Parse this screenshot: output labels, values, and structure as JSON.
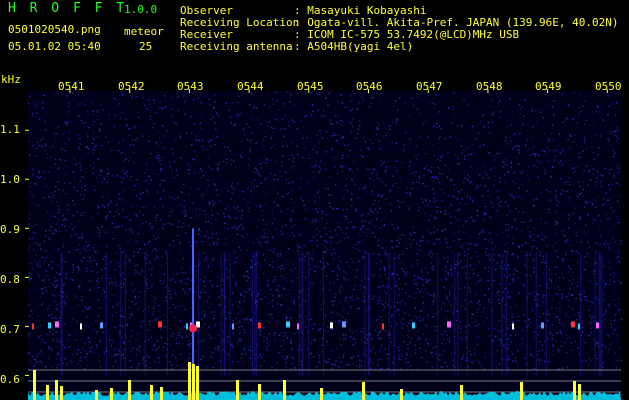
{
  "header": {
    "app_name": "H R O F F T",
    "version": "1.0.0",
    "filename": "0501020540.png",
    "datetime": "05.01.02 05:40",
    "meteor_label": "meteor",
    "meteor_count": "25"
  },
  "info": [
    {
      "key": "Observer",
      "value": ": Masayuki Kobayashi"
    },
    {
      "key": "Receiving Location",
      "value": ": Ogata-vill. Akita-Pref. JAPAN (139.96E, 40.02N)"
    },
    {
      "key": "Receiver",
      "value": ": ICOM IC-575 53.7492(@LCD)MHz USB"
    },
    {
      "key": "Receiving antenna",
      "value": ": A504HB(yagi 4el)"
    }
  ],
  "colors": {
    "background": "#000000",
    "header_green": "#20ff20",
    "axis_yellow": "#ffff33",
    "spectrogram_blue": "#0a0a8a",
    "meter_cyan": "#00e0ff"
  },
  "chart_data": {
    "type": "heatmap",
    "y_unit_label": "kHz",
    "y_ticks": [
      "1.1",
      "1.0",
      "0.9",
      "0.8",
      "0.7",
      "0.6"
    ],
    "y_values": [
      1.1,
      1.0,
      0.9,
      0.8,
      0.7,
      0.6
    ],
    "x_ticks": [
      "0541",
      "0542",
      "0543",
      "0544",
      "0545",
      "0546",
      "0547",
      "0548",
      "0549",
      "0550"
    ],
    "ylim": [
      0.55,
      1.18
    ],
    "meteor_band_khz": 0.7
  }
}
